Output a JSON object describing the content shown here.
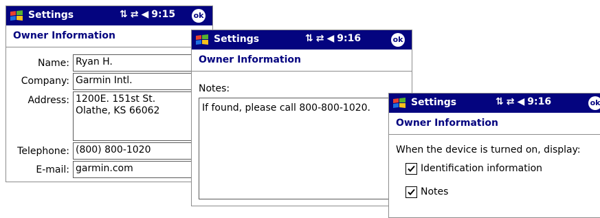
{
  "colors": {
    "titlebar": "#04047f",
    "header_text": "#04047f"
  },
  "windows": [
    {
      "title": "Settings",
      "time": "9:15",
      "ok_label": "ok",
      "header": "Owner Information",
      "fields": {
        "name_label": "Name:",
        "name_value": "Ryan H.",
        "company_label": "Company:",
        "company_value": "Garmin Intl.",
        "address_label": "Address:",
        "address_value": "1200E. 151st St.\nOlathe, KS  66062",
        "telephone_label": "Telephone:",
        "telephone_value": "(800) 800-1020",
        "email_label": "E-mail:",
        "email_value": "garmin.com"
      }
    },
    {
      "title": "Settings",
      "time": "9:16",
      "ok_label": "ok",
      "header": "Owner Information",
      "notes_label": "Notes:",
      "notes_value": "If found, please call 800-800-1020."
    },
    {
      "title": "Settings",
      "time": "9:16",
      "ok_label": "ok",
      "header": "Owner Information",
      "display_prompt": "When the device is turned on, display:",
      "options": [
        {
          "label": "Identification information",
          "checked": true
        },
        {
          "label": "Notes",
          "checked": true
        }
      ]
    }
  ]
}
